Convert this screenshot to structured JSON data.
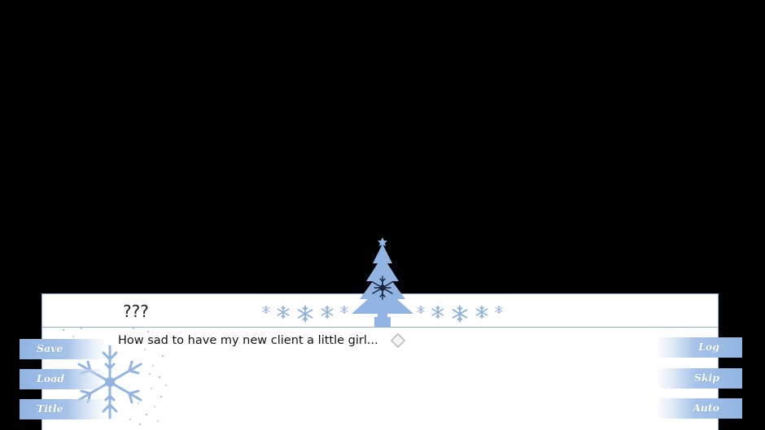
{
  "dialogue": {
    "speaker": "???",
    "text": "How sad to have my new client a little girl..."
  },
  "menu_left": [
    {
      "label": "Save"
    },
    {
      "label": "Load"
    },
    {
      "label": "Title"
    }
  ],
  "menu_right": [
    {
      "label": "Log"
    },
    {
      "label": "Skip"
    },
    {
      "label": "Auto"
    }
  ],
  "colors": {
    "accent": "#91b4e2",
    "border": "#8fb2dd",
    "background": "#000000",
    "dialogue_bg": "#ffffff"
  },
  "icons": {
    "advance": "diamond-icon",
    "decoration": [
      "christmas-tree-icon",
      "snowflake-icon"
    ]
  }
}
